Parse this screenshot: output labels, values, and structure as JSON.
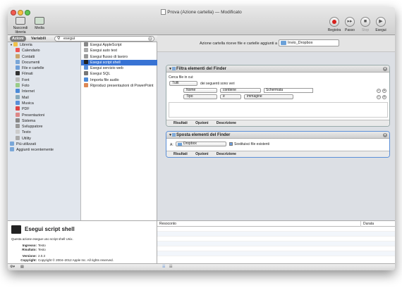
{
  "window": {
    "title": "Prova (Azione cartella) — Modificato"
  },
  "toolbar": {
    "left": [
      {
        "label": "Nascondi libreria"
      },
      {
        "label": "Media"
      }
    ],
    "right": [
      {
        "label": "Registra"
      },
      {
        "label": "Passo"
      },
      {
        "label": "Stop"
      },
      {
        "label": "Esegui"
      }
    ]
  },
  "library_bar": {
    "actions_tab": "Azioni",
    "variables_tab": "Variabili",
    "search_value": "esegui"
  },
  "categories": [
    {
      "label": "Libreria",
      "color": "#f0c24a"
    },
    {
      "label": "Calendario",
      "color": "#e55"
    },
    {
      "label": "Contatti",
      "color": "#c9a36a"
    },
    {
      "label": "Documenti",
      "color": "#7aa7d8"
    },
    {
      "label": "File e cartelle",
      "color": "#6f9fd8"
    },
    {
      "label": "Filmati",
      "color": "#333"
    },
    {
      "label": "Font",
      "color": "#bbb"
    },
    {
      "label": "Foto",
      "color": "#9c8"
    },
    {
      "label": "Internet",
      "color": "#4b8ad8"
    },
    {
      "label": "Mail",
      "color": "#8ab"
    },
    {
      "label": "Musica",
      "color": "#5a8fd8"
    },
    {
      "label": "PDF",
      "color": "#d44"
    },
    {
      "label": "Presentazioni",
      "color": "#d88"
    },
    {
      "label": "Sistema",
      "color": "#888"
    },
    {
      "label": "Sviluppatore",
      "color": "#999"
    },
    {
      "label": "Testo",
      "color": "#ccc"
    },
    {
      "label": "Utility",
      "color": "#aaa"
    },
    {
      "label": "Più utilizzati",
      "color": "#7aa7d8"
    },
    {
      "label": "Aggiunti recentemente",
      "color": "#7aa7d8"
    }
  ],
  "actions": [
    {
      "label": "Esegui AppleScript",
      "color": "#888",
      "selected": false
    },
    {
      "label": "Esegui auto test",
      "color": "#aaa",
      "selected": false
    },
    {
      "label": "Esegui flusso di lavoro",
      "color": "#999",
      "selected": false
    },
    {
      "label": "Esegui script shell",
      "color": "#222",
      "selected": true
    },
    {
      "label": "Esegui servizio web",
      "color": "#5a8fd8",
      "selected": false
    },
    {
      "label": "Esegui SQL",
      "color": "#777",
      "selected": false
    },
    {
      "label": "Importa file audio",
      "color": "#4b8ad8",
      "selected": false
    },
    {
      "label": "Riproduci presentazioni di PowerPoint",
      "color": "#d85",
      "selected": false
    }
  ],
  "description": {
    "title": "Esegui script shell",
    "summary": "Questa azione esegue uno script shell Unix.",
    "input_label": "Ingresso:",
    "input_value": "Testo",
    "result_label": "Risultato:",
    "result_value": "Testo",
    "version_label": "Versione:",
    "version_value": "2.0.3",
    "copyright_label": "Copyright:",
    "copyright_value": "Copyright © 2004–2012 Apple Inc.  All rights reserved."
  },
  "workflow_header": {
    "text": "Azione cartella riceve file e cartelle aggiunti a",
    "folder": "Invio_Dropbox"
  },
  "block1": {
    "title": "Filtra elementi del Finder",
    "subtitle": "Cerca file in cui:",
    "match_mode": "Tutti",
    "match_suffix": "dei seguenti sono veri",
    "rule1": {
      "field": "Nome",
      "op": "contiene",
      "value": "Schermata"
    },
    "rule2": {
      "field": "Tipo",
      "op": "è",
      "value": "immagine"
    },
    "footer": [
      "Risultati",
      "Opzioni",
      "Descrizione"
    ]
  },
  "block2": {
    "title": "Sposta elementi del Finder",
    "to_label": "A:",
    "destination": "Dropbox",
    "replace_label": "Sostituisci file esistenti",
    "footer": [
      "Risultati",
      "Opzioni",
      "Descrizione"
    ]
  },
  "log": {
    "col_log": "Resoconto",
    "col_duration": "Durata"
  }
}
